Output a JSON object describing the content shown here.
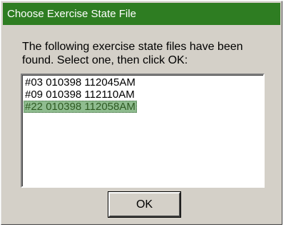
{
  "dialog": {
    "title": "Choose Exercise State File",
    "prompt": "The following exercise state files have been found. Select one, then click OK:",
    "files": [
      "#03 010398 112045AM",
      "#09 010398 112110AM",
      "#22 010398 112058AM"
    ],
    "selected_index": 2,
    "ok_label": "OK"
  },
  "colors": {
    "titlebar": "#2e7d22",
    "selection": "#8fbc8f"
  }
}
